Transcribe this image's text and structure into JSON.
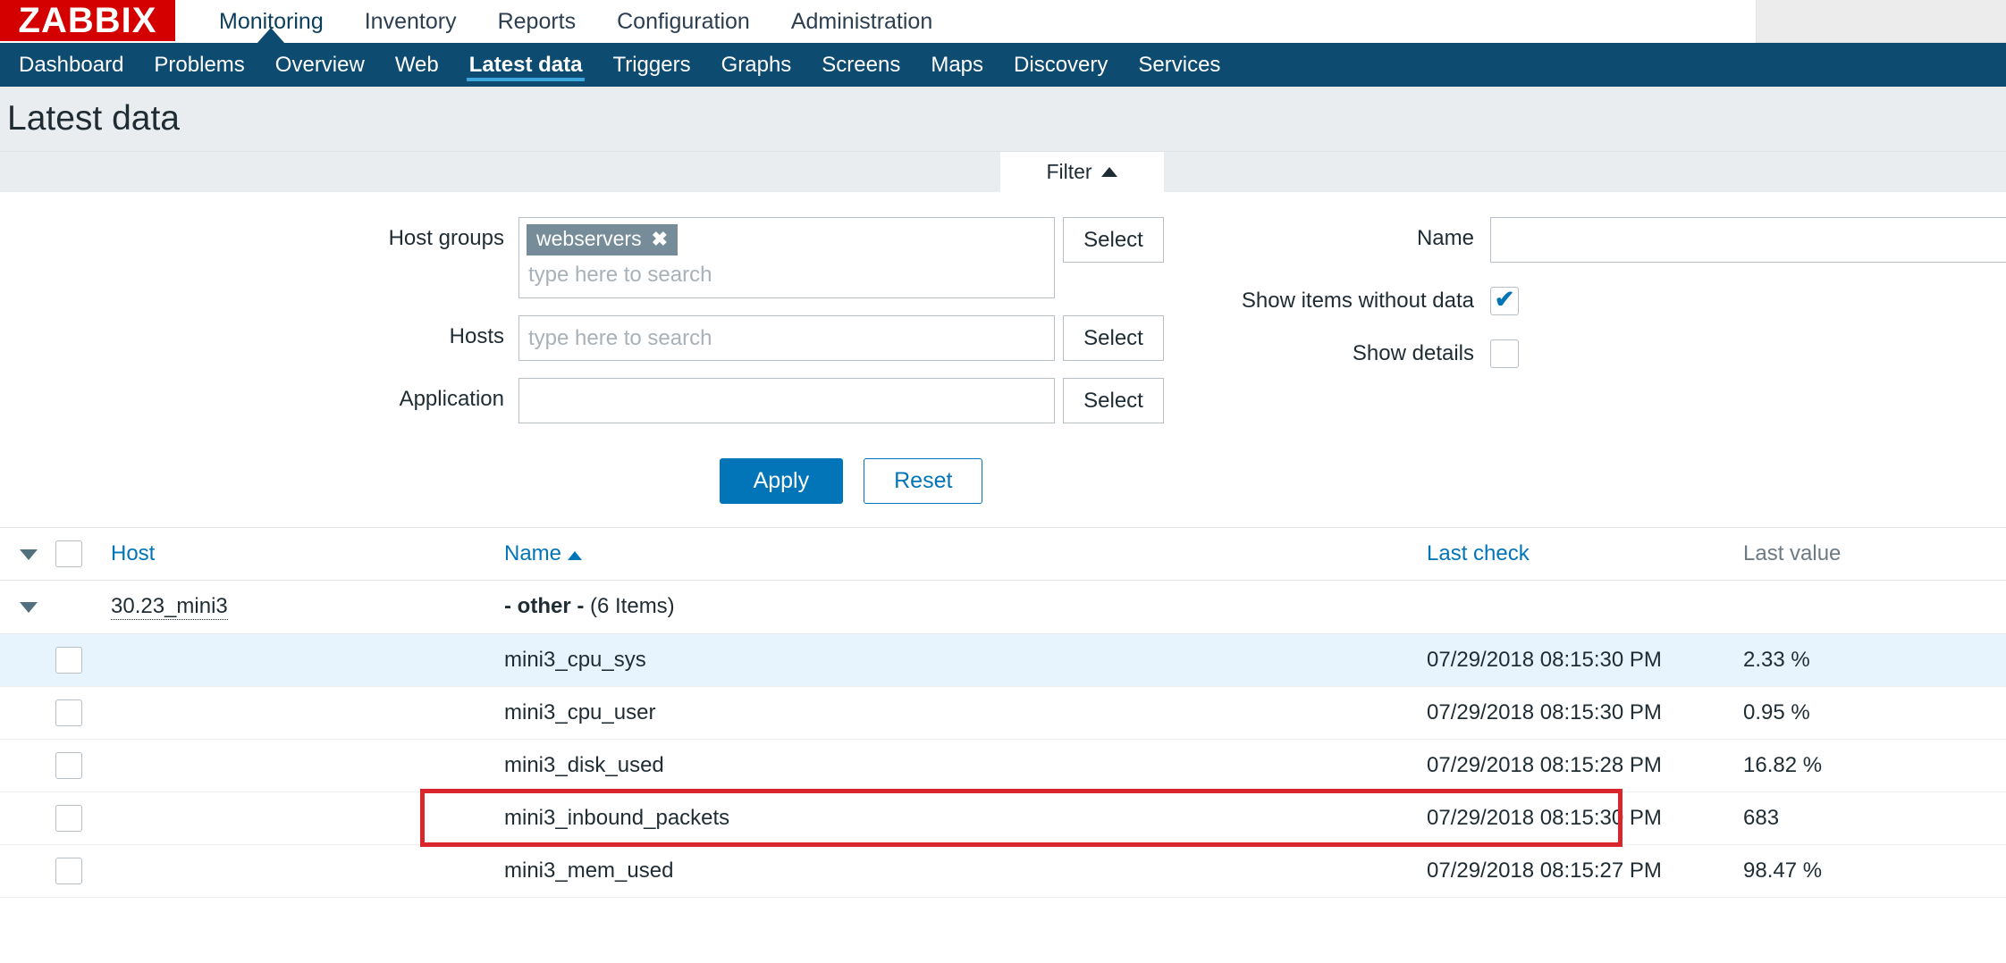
{
  "brand": {
    "logo_text": "ZABBIX",
    "logo_color": "#d40000"
  },
  "mainnav": {
    "items": [
      {
        "label": "Monitoring",
        "selected": true
      },
      {
        "label": "Inventory",
        "selected": false
      },
      {
        "label": "Reports",
        "selected": false
      },
      {
        "label": "Configuration",
        "selected": false
      },
      {
        "label": "Administration",
        "selected": false
      }
    ]
  },
  "subnav": {
    "items": [
      {
        "label": "Dashboard",
        "selected": false
      },
      {
        "label": "Problems",
        "selected": false
      },
      {
        "label": "Overview",
        "selected": false
      },
      {
        "label": "Web",
        "selected": false
      },
      {
        "label": "Latest data",
        "selected": true
      },
      {
        "label": "Triggers",
        "selected": false
      },
      {
        "label": "Graphs",
        "selected": false
      },
      {
        "label": "Screens",
        "selected": false
      },
      {
        "label": "Maps",
        "selected": false
      },
      {
        "label": "Discovery",
        "selected": false
      },
      {
        "label": "Services",
        "selected": false
      }
    ]
  },
  "page": {
    "title": "Latest data"
  },
  "filter": {
    "tab_label": "Filter",
    "tab_toggle_icon": "triangle-up-icon",
    "host_groups": {
      "label": "Host groups",
      "chips": [
        {
          "label": "webservers",
          "remove_icon": "close-icon"
        }
      ],
      "placeholder": "type here to search",
      "select_label": "Select"
    },
    "hosts": {
      "label": "Hosts",
      "value": "",
      "placeholder": "type here to search",
      "select_label": "Select"
    },
    "application": {
      "label": "Application",
      "value": "",
      "placeholder": "",
      "select_label": "Select"
    },
    "name": {
      "label": "Name",
      "value": "",
      "placeholder": ""
    },
    "show_items_without_data": {
      "label": "Show items without data",
      "checked": true,
      "tick": "✔"
    },
    "show_details": {
      "label": "Show details",
      "checked": false
    },
    "apply_label": "Apply",
    "reset_label": "Reset",
    "accent_color": "#0275b8"
  },
  "table": {
    "collapse_icon": "triangle-down-icon",
    "headers": {
      "host": "Host",
      "name": "Name",
      "name_sort_icon": "sort-ascending-icon",
      "last_check": "Last check",
      "last_value": "Last value"
    },
    "group": {
      "host": "30.23_mini3",
      "application": "- other -",
      "items_count": "(6 Items)"
    },
    "rows": [
      {
        "name": "mini3_cpu_sys",
        "last_check": "07/29/2018 08:15:30 PM",
        "last_value": "2.33 %",
        "highlighted": true,
        "annotated": false
      },
      {
        "name": "mini3_cpu_user",
        "last_check": "07/29/2018 08:15:30 PM",
        "last_value": "0.95 %",
        "highlighted": false,
        "annotated": false
      },
      {
        "name": "mini3_disk_used",
        "last_check": "07/29/2018 08:15:28 PM",
        "last_value": "16.82 %",
        "highlighted": false,
        "annotated": false
      },
      {
        "name": "mini3_inbound_packets",
        "last_check": "07/29/2018 08:15:30 PM",
        "last_value": "683",
        "highlighted": false,
        "annotated": true
      },
      {
        "name": "mini3_mem_used",
        "last_check": "07/29/2018 08:15:27 PM",
        "last_value": "98.47 %",
        "highlighted": false,
        "annotated": false
      }
    ]
  },
  "annotation": {
    "color": "#d9262c",
    "target_row": "mini3_inbound_packets"
  }
}
